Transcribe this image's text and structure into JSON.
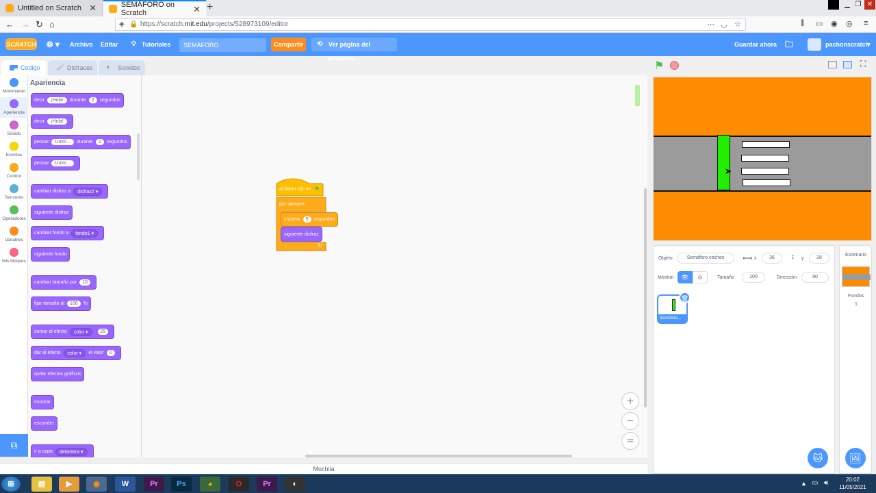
{
  "browser": {
    "tabs": [
      {
        "title": "Untitled on Scratch",
        "active": false
      },
      {
        "title": "SEMÁFORO on Scratch",
        "active": true
      }
    ],
    "url_prefix": "https://scratch.",
    "url_domain": "mit.edu",
    "url_path": "/projects/528973109/editor"
  },
  "menubar": {
    "logo": "SCRATCH",
    "file": "Archivo",
    "edit": "Editar",
    "tutorials": "Tutoriales",
    "project_title": "SEMÁFORO",
    "share": "Compartir",
    "project_page": "Ver página del proyecto",
    "save_now": "Guardar ahora",
    "username": "pachonscratch"
  },
  "editor_tabs": {
    "code": "Código",
    "costumes": "Disfraces",
    "sounds": "Sonidos"
  },
  "categories": [
    {
      "label": "Movimiento",
      "color": "#4c97ff"
    },
    {
      "label": "Apariencia",
      "color": "#9966ff"
    },
    {
      "label": "Sonido",
      "color": "#cf63cf"
    },
    {
      "label": "Eventos",
      "color": "#ffd500"
    },
    {
      "label": "Control",
      "color": "#ffab19"
    },
    {
      "label": "Sensores",
      "color": "#5cb1d6"
    },
    {
      "label": "Operadores",
      "color": "#59c059"
    },
    {
      "label": "Variables",
      "color": "#ff8c1a"
    },
    {
      "label": "Mis bloques",
      "color": "#ff6680"
    }
  ],
  "flyout": {
    "heading": "Apariencia",
    "say_for": {
      "a": "decir",
      "b": "¡Hola!",
      "c": "durante",
      "d": "2",
      "e": "segundos"
    },
    "say": {
      "a": "decir",
      "b": "¡Hola!"
    },
    "think_for": {
      "a": "pensar",
      "b": "Umm...",
      "c": "durante",
      "d": "2",
      "e": "segundos"
    },
    "think": {
      "a": "pensar",
      "b": "Umm..."
    },
    "switch_costume": {
      "a": "cambiar disfraz a",
      "b": "disfraz2"
    },
    "next_costume": "siguiente disfraz",
    "switch_backdrop": {
      "a": "cambiar fondo a",
      "b": "fondo1"
    },
    "next_backdrop": "siguiente fondo",
    "change_size": {
      "a": "cambiar tamaño por",
      "b": "10"
    },
    "set_size": {
      "a": "fijar tamaño al",
      "b": "100",
      "c": "%"
    },
    "change_effect": {
      "a": "sumar al efecto",
      "b": "color",
      "c": "25"
    },
    "set_effect": {
      "a": "dar al efecto",
      "b": "color",
      "c": "el valor",
      "d": "0"
    },
    "clear_effects": "quitar efectos gráficos",
    "show": "mostrar",
    "hide": "esconder",
    "go_layer": {
      "a": "ir a capa",
      "b": "delantera"
    }
  },
  "script": {
    "hat": "al hacer clic en",
    "forever": "por siempre",
    "wait": {
      "a": "esperar",
      "b": "5",
      "c": "segundos"
    },
    "next_costume": "siguiente disfraz"
  },
  "backpack": "Mochila",
  "sprite_info": {
    "sprite_label": "Objeto",
    "sprite_name": "Semáforo coches",
    "x_label": "x",
    "x_value": "36",
    "y_label": "y",
    "y_value": "28",
    "show_label": "Mostrar",
    "size_label": "Tamaño",
    "size_value": "100",
    "direction_label": "Dirección",
    "direction_value": "90",
    "thumb_name": "Semáforo..."
  },
  "stage_panel": {
    "title": "Escenario",
    "backdrops_label": "Fondos",
    "backdrops_count": "1"
  },
  "taskbar": {
    "time": "20:02",
    "date": "11/05/2021"
  },
  "colors": {
    "scratch_blue": "#4c97ff",
    "looks_purple": "#9966ff",
    "events_yellow": "#ffbf00",
    "control_orange": "#ffab19",
    "stage_orange": "#ff8c00",
    "light_green": "#22ee00"
  }
}
